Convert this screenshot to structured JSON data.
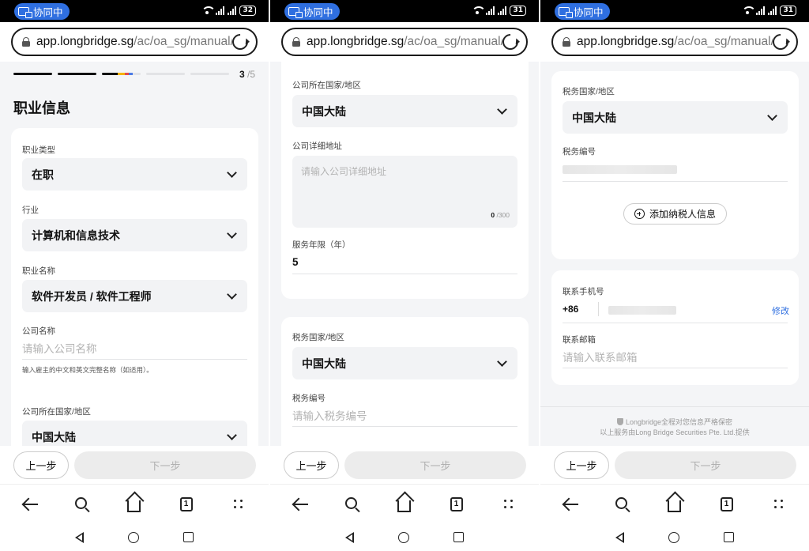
{
  "status": {
    "badge": "协同中",
    "battery": [
      "32",
      "31",
      "31"
    ]
  },
  "browser": {
    "url_host": "app.longbridge.sg",
    "url_path": "/ac/oa_sg/manual/er"
  },
  "progress": {
    "current": "3",
    "total": "/5",
    "fraction": 0.5
  },
  "panel1": {
    "title": "职业信息",
    "job_type_label": "职业类型",
    "job_type_value": "在职",
    "industry_label": "行业",
    "industry_value": "计算机和信息技术",
    "position_label": "职业名称",
    "position_value": "软件开发员 / 软件工程师",
    "company_label": "公司名称",
    "company_placeholder": "请输入公司名称",
    "company_hint": "输入雇主的中文和英文完整名称（如适用）。",
    "country_label": "公司所在国家/地区",
    "country_value": "中国大陆"
  },
  "panel2": {
    "country_label": "公司所在国家/地区",
    "country_value": "中国大陆",
    "address_label": "公司详细地址",
    "address_placeholder": "请输入公司详细地址",
    "address_count": "0",
    "address_max": "/300",
    "years_label": "服务年限（年）",
    "years_value": "5",
    "tax_country_label": "税务国家/地区",
    "tax_country_value": "中国大陆",
    "tax_id_label": "税务编号",
    "tax_id_placeholder": "请输入税务编号"
  },
  "panel3": {
    "tax_country_label": "税务国家/地区",
    "tax_country_value": "中国大陆",
    "tax_id_label": "税务编号",
    "add_taxpayer": "添加纳税人信息",
    "phone_label": "联系手机号",
    "phone_code": "+86",
    "modify": "修改",
    "email_label": "联系邮箱",
    "email_placeholder": "请输入联系邮箱",
    "footer_line1": "Longbridge全程对您信息严格保密",
    "footer_line2": "以上服务由Long Bridge Securities Pte. Ltd.提供"
  },
  "buttons": {
    "prev": "上一步",
    "next": "下一步"
  },
  "navbar": {
    "tabs_count": "1"
  },
  "colors": {
    "accent": "#2f6fe0",
    "muted_button": "#ececec"
  }
}
